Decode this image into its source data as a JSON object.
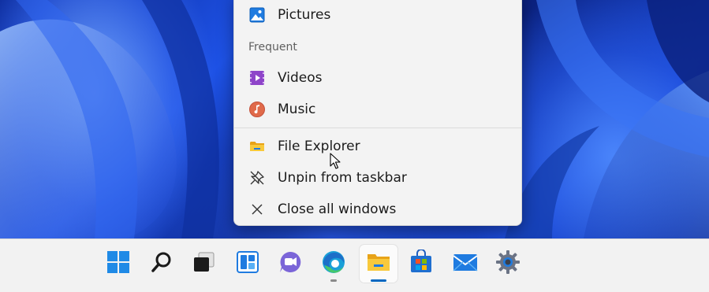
{
  "jumplist": {
    "pinned_items": [
      {
        "label": "Pictures",
        "icon": "pictures-icon"
      }
    ],
    "frequent_header": "Frequent",
    "frequent_items": [
      {
        "label": "Videos",
        "icon": "videos-icon"
      },
      {
        "label": "Music",
        "icon": "music-icon"
      }
    ],
    "actions": [
      {
        "label": "File Explorer",
        "icon": "folder-icon"
      },
      {
        "label": "Unpin from taskbar",
        "icon": "unpin-icon"
      },
      {
        "label": "Close all windows",
        "icon": "close-icon"
      }
    ]
  },
  "taskbar": {
    "items": [
      {
        "name": "start",
        "icon": "windows-start-icon"
      },
      {
        "name": "search",
        "icon": "search-icon"
      },
      {
        "name": "task-view",
        "icon": "task-view-icon"
      },
      {
        "name": "widgets",
        "icon": "widgets-icon"
      },
      {
        "name": "chat",
        "icon": "teams-chat-icon"
      },
      {
        "name": "edge",
        "icon": "edge-browser-icon"
      },
      {
        "name": "file-explorer",
        "icon": "file-explorer-icon",
        "active": true
      },
      {
        "name": "store",
        "icon": "microsoft-store-icon"
      },
      {
        "name": "mail",
        "icon": "mail-icon"
      },
      {
        "name": "settings",
        "icon": "settings-gear-icon"
      }
    ]
  },
  "colors": {
    "accent": "#0067c0",
    "wallpaper_primary": "#1e52e6",
    "taskbar_bg": "#f2f2f2",
    "menu_bg": "#f3f3f3"
  }
}
